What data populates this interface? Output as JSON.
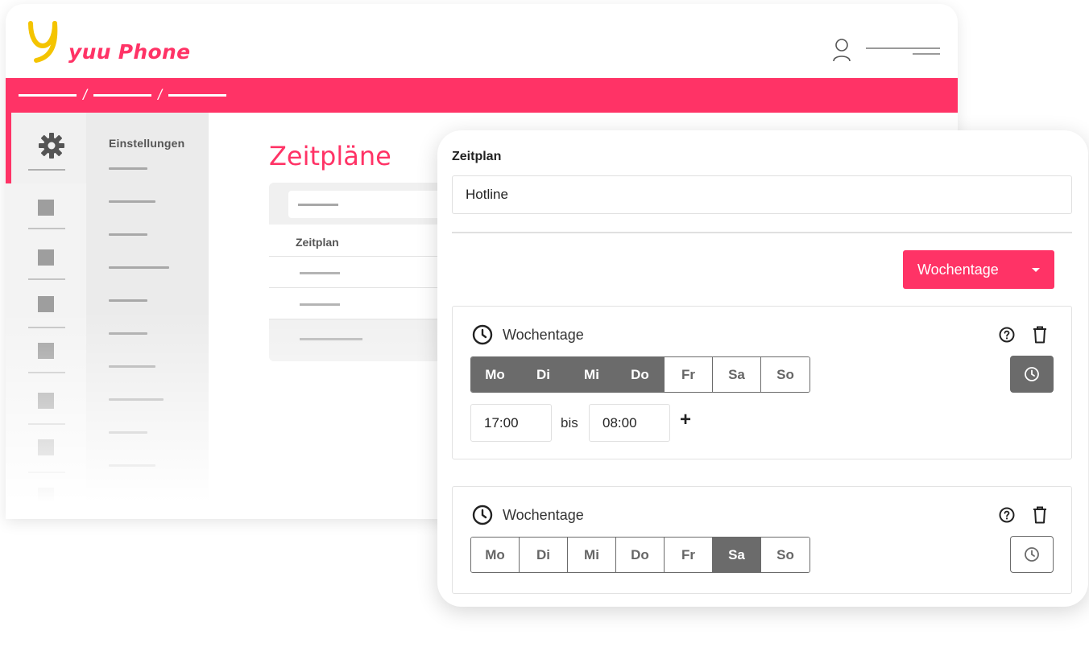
{
  "app": {
    "name": "yuu Phone",
    "brand_color": "#ff3366",
    "logo_color": "#f4c400"
  },
  "header": {
    "user_icon": "user-icon"
  },
  "sidebar": {
    "section_title": "Einstellungen",
    "active_icon": "gear-icon"
  },
  "main": {
    "title": "Zeitpläne",
    "table": {
      "column_header": "Zeitplan"
    }
  },
  "panel": {
    "label": "Zeitplan",
    "name_value": "Hotline",
    "type_button_label": "Wochentage",
    "rules": [
      {
        "title": "Wochentage",
        "days": [
          {
            "label": "Mo",
            "active": true
          },
          {
            "label": "Di",
            "active": true
          },
          {
            "label": "Mi",
            "active": true
          },
          {
            "label": "Do",
            "active": true
          },
          {
            "label": "Fr",
            "active": false
          },
          {
            "label": "Sa",
            "active": false
          },
          {
            "label": "So",
            "active": false
          }
        ],
        "time_mode_active": true,
        "time_from": "17:00",
        "time_separator": "bis",
        "time_to": "08:00",
        "add_label": "+"
      },
      {
        "title": "Wochentage",
        "days": [
          {
            "label": "Mo",
            "active": false
          },
          {
            "label": "Di",
            "active": false
          },
          {
            "label": "Mi",
            "active": false
          },
          {
            "label": "Do",
            "active": false
          },
          {
            "label": "Fr",
            "active": false
          },
          {
            "label": "Sa",
            "active": true
          },
          {
            "label": "So",
            "active": false
          }
        ],
        "time_mode_active": false
      }
    ]
  }
}
